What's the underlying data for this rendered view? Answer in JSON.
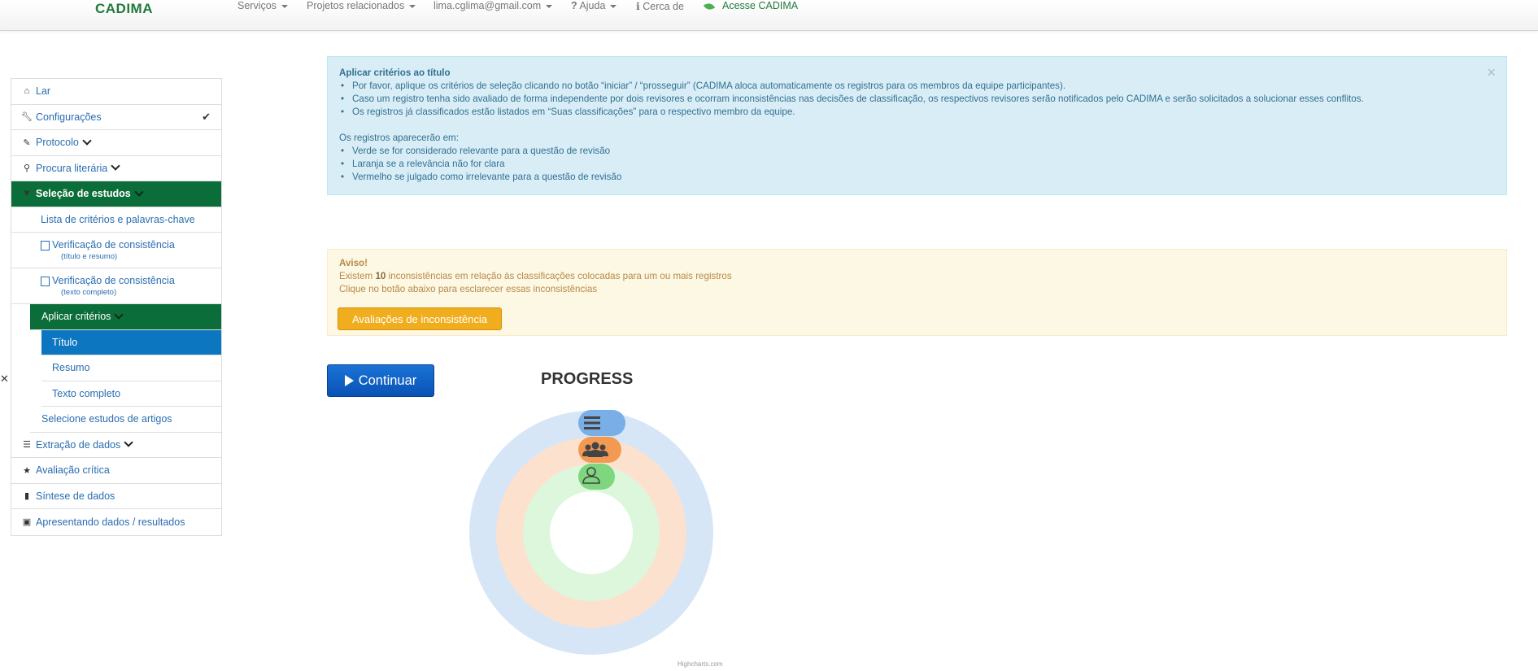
{
  "navbar": {
    "brand": "CADIMA",
    "items": [
      {
        "label": "Serviços",
        "dropdown": true
      },
      {
        "label": "Projetos relacionados",
        "dropdown": true
      },
      {
        "label": "lima.cglima@gmail.com",
        "dropdown": true
      },
      {
        "icon": "?",
        "label": "Ajuda",
        "dropdown": true
      },
      {
        "icon": "ℹ",
        "label": "Cerca de",
        "dropdown": false
      },
      {
        "label": "Acesse CADIMA",
        "dropdown": false
      }
    ]
  },
  "sidebar": {
    "items": [
      {
        "label": "Lar",
        "icon": "home-icon"
      },
      {
        "label": "Configurações",
        "icon": "wrench-icon"
      },
      {
        "label": "Protocolo",
        "icon": "pencil-icon"
      },
      {
        "label": "Procura literária",
        "icon": "search-icon"
      },
      {
        "label": "Seleção de estudos",
        "icon": "filter-icon"
      },
      {
        "label": "Lista de critérios e palavras-chave"
      },
      {
        "label": "Verificação de consistência",
        "sub": "(título e resumo)"
      },
      {
        "label": "Verificação de consistência",
        "sub": "(texto completo)"
      },
      {
        "label": "Aplicar critérios"
      },
      {
        "label": "Título"
      },
      {
        "label": "Resumo"
      },
      {
        "label": "Texto completo"
      },
      {
        "label": "Selecione estudos de artigos"
      },
      {
        "label": "Extração de dados",
        "icon": "list-icon"
      },
      {
        "label": "Avaliação crítica",
        "icon": "star-icon"
      },
      {
        "label": "Síntese de dados",
        "icon": "file-icon"
      },
      {
        "label": "Apresentando dados / resultados",
        "icon": "image-icon"
      }
    ]
  },
  "info": {
    "title": "Aplicar critérios ao título",
    "bullets": [
      "Por favor, aplique os critérios de seleção clicando no botão “iniciar” / “prosseguir” (CADIMA aloca automaticamente os registros para os membros da equipe participantes).",
      "Caso um registro tenha sido avaliado de forma independente por dois revisores e ocorram inconsistências nas decisões de classificação, os respectivos revisores serão notificados pelo CADIMA e serão solicitados a solucionar esses conflitos.",
      "Os registros já classificados estão listados em “Suas classificações” para o respectivo membro da equipe."
    ],
    "intro2": "Os registros aparecerão em:",
    "bullets2": [
      "Verde se for considerado relevante para a questão de revisão",
      "Laranja se a relevância não for clara",
      "Vermelho se julgado como irrelevante para a questão de revisão"
    ],
    "close": "×"
  },
  "warning": {
    "title": "Aviso!",
    "pre": "Existem ",
    "count": "10",
    "post": " inconsistências em relação às classificações colocadas para um ou mais registros",
    "line2": "Clique no botão abaixo para esclarecer essas inconsistências",
    "button": "Avaliações de inconsistência"
  },
  "continue_button": "Continuar",
  "progress": {
    "title": "PROGRESS",
    "credits": "Highcharts.com",
    "colors": {
      "outer": "#d6e6f7",
      "middle": "#fde1cf",
      "inner": "#dcf7dc",
      "track_outer": "#5b9bd5",
      "track_middle": "#f08c3a",
      "track_inner": "#5cc85c"
    }
  }
}
